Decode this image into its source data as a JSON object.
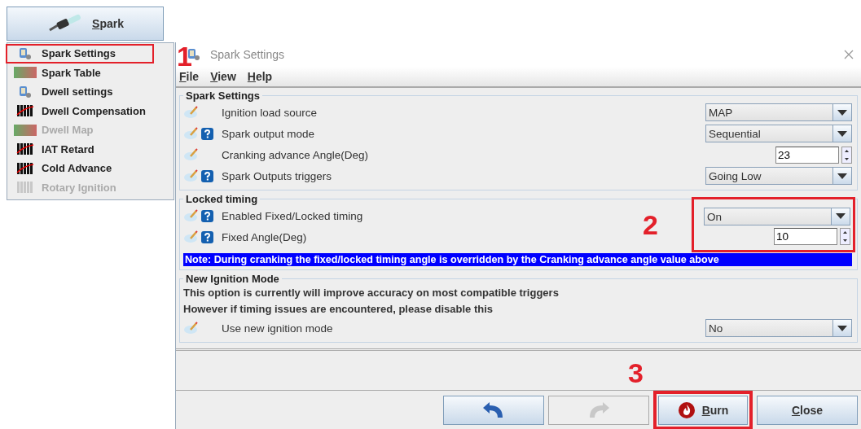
{
  "launcher": {
    "label": "Spark"
  },
  "menu": [
    {
      "label": "Spark Settings",
      "kind": "settings",
      "disabled": false,
      "callout": "1"
    },
    {
      "label": "Spark Table",
      "kind": "table",
      "disabled": false
    },
    {
      "label": "Dwell settings",
      "kind": "settings",
      "disabled": false
    },
    {
      "label": "Dwell Compensation",
      "kind": "curve",
      "disabled": false
    },
    {
      "label": "Dwell Map",
      "kind": "table",
      "disabled": true
    },
    {
      "label": "IAT Retard",
      "kind": "curve",
      "disabled": false
    },
    {
      "label": "Cold Advance",
      "kind": "curve",
      "disabled": false
    },
    {
      "label": "Rotary Ignition",
      "kind": "curve",
      "disabled": true
    }
  ],
  "dialog": {
    "title": "Spark Settings",
    "menus": [
      "File",
      "View",
      "Help"
    ],
    "groups": [
      {
        "title": "Spark Settings",
        "rows": [
          {
            "label": "Ignition load source",
            "help": false,
            "kind": "dropdown",
            "value": "MAP"
          },
          {
            "label": "Spark output mode",
            "help": true,
            "kind": "dropdown",
            "value": "Sequential"
          },
          {
            "label": "Cranking advance Angle(Deg)",
            "help": false,
            "kind": "spinner",
            "value": "23"
          },
          {
            "label": "Spark Outputs triggers",
            "help": true,
            "kind": "dropdown",
            "value": "Going Low"
          }
        ]
      },
      {
        "title": "Locked timing",
        "callout": "2",
        "rows": [
          {
            "label": "Enabled Fixed/Locked timing",
            "help": true,
            "kind": "dropdown",
            "value": "On"
          },
          {
            "label": "Fixed Angle(Deg)",
            "help": true,
            "kind": "spinner",
            "value": "10"
          }
        ],
        "note": "Note: During cranking the fixed/locked timing angle is overridden by the Cranking advance angle value above"
      },
      {
        "title": "New Ignition Mode",
        "text": [
          "This option is currently will improve accuracy on most compatible triggers",
          "However if timing issues are encountered, please disable this"
        ],
        "rows": [
          {
            "label": "Use new ignition mode",
            "help": false,
            "kind": "dropdown",
            "value": "No"
          }
        ]
      }
    ],
    "buttons": [
      {
        "kind": "undo",
        "disabled": false
      },
      {
        "kind": "redo",
        "disabled": true
      },
      {
        "kind": "burn",
        "label": "Burn",
        "disabled": false,
        "callout": "3"
      },
      {
        "kind": "close",
        "label": "Close",
        "disabled": false
      }
    ]
  }
}
